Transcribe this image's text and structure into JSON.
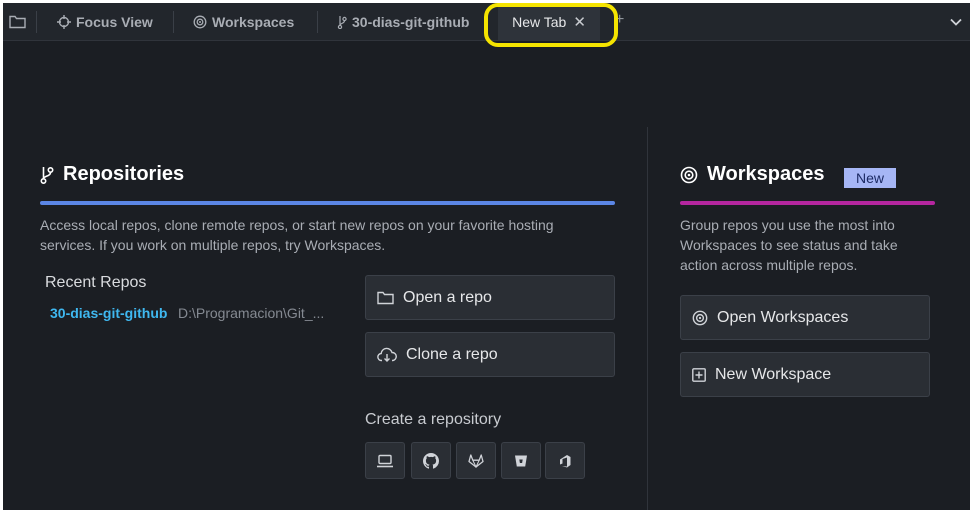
{
  "tabs": [
    {
      "label": "Focus View",
      "icon": "target-icon"
    },
    {
      "label": "Workspaces",
      "icon": "workspaces-icon"
    },
    {
      "label": "30-dias-git-github",
      "icon": "branch-icon"
    },
    {
      "label": "New Tab",
      "icon": "close-icon",
      "active": true
    }
  ],
  "repositories": {
    "title": "Repositories",
    "description_line1": "Access local repos, clone remote repos, or start new repos on your favorite hosting",
    "description_line2": "services. If you work on multiple repos, try Workspaces.",
    "recent_title": "Recent Repos",
    "recent": [
      {
        "name": "30-dias-git-github",
        "path": "D:\\Programacion\\Git_..."
      }
    ],
    "open_label": "Open a repo",
    "clone_label": "Clone a repo",
    "create_title": "Create a repository",
    "providers": [
      "local-icon",
      "github-icon",
      "gitlab-icon",
      "bitbucket-icon",
      "azure-devops-icon"
    ],
    "accent_color": "#5b86e5"
  },
  "workspaces": {
    "title": "Workspaces",
    "badge": "New",
    "description_line1": "Group repos you use the most into",
    "description_line2": "Workspaces to see status and take",
    "description_line3": "action across multiple repos.",
    "open_label": "Open Workspaces",
    "new_label": "New Workspace",
    "accent_color": "#b5269f"
  },
  "highlight_color": "#f5e400"
}
